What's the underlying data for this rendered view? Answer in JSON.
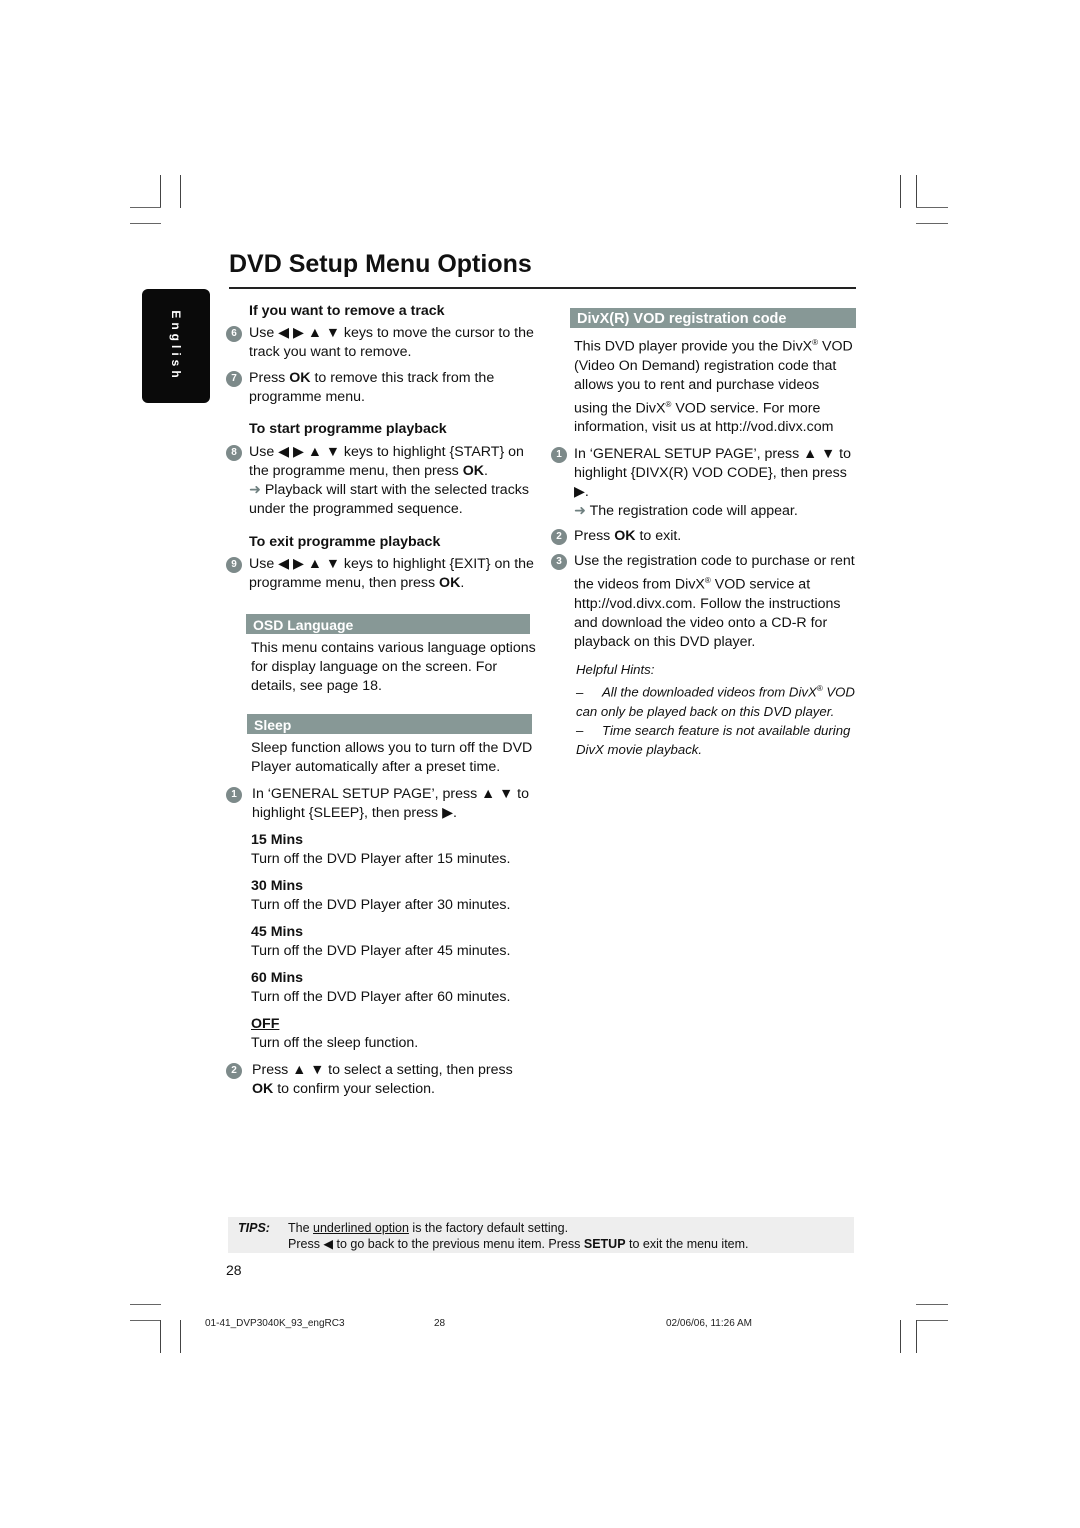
{
  "page": {
    "title": "DVD Setup Menu Options",
    "language_tab": "English",
    "page_number": "28"
  },
  "left_column": {
    "remove_track": {
      "heading": "If you want to remove a track",
      "steps": [
        {
          "num": "6",
          "pre": "Use ",
          "keys": "◀ ▶ ▲ ▼",
          "post": " keys to move the cursor to the track you want to remove."
        },
        {
          "num": "7",
          "pre": "Press ",
          "bold": "OK",
          "post": " to remove this track from the programme menu."
        }
      ]
    },
    "start_playback": {
      "heading": "To start programme playback",
      "step": {
        "num": "8",
        "pre": "Use ",
        "keys": "◀ ▶ ▲ ▼",
        "mid": " keys to highlight {START} on the programme menu, then press ",
        "bold": "OK",
        "post": "."
      },
      "result_arrow": "➜",
      "result": " Playback will start with the selected tracks under the programmed sequence."
    },
    "exit_playback": {
      "heading": "To exit programme playback",
      "step": {
        "num": "9",
        "pre": "Use ",
        "keys": "◀ ▶ ▲ ▼",
        "mid": " keys to highlight {EXIT} on the programme menu, then press ",
        "bold": "OK",
        "post": "."
      }
    },
    "osd_language": {
      "heading": "OSD Language",
      "body": "This menu contains various language options for display language on the screen. For details, see page 18."
    },
    "sleep": {
      "heading": "Sleep",
      "body": "Sleep function allows you to turn off the DVD Player automatically after a preset time.",
      "step1": {
        "num": "1",
        "text": "In ‘GENERAL SETUP PAGE’, press ▲ ▼ to highlight {SLEEP}, then press ▶."
      },
      "options": [
        {
          "title": "15 Mins",
          "desc": "Turn off the DVD Player after 15 minutes.",
          "default": false
        },
        {
          "title": "30 Mins",
          "desc": "Turn off the DVD Player after 30 minutes.",
          "default": false
        },
        {
          "title": "45 Mins",
          "desc": "Turn off the DVD Player after 45 minutes.",
          "default": false
        },
        {
          "title": "60 Mins",
          "desc": "Turn off the DVD Player after 60 minutes.",
          "default": false
        },
        {
          "title": "OFF",
          "desc": "Turn off the sleep function.",
          "default": true
        }
      ],
      "step2": {
        "num": "2",
        "pre": "Press ▲ ▼ to select a setting, then press ",
        "bold": "OK",
        "post": " to confirm your selection."
      }
    }
  },
  "right_column": {
    "divx": {
      "heading": "DivX(R) VOD registration code",
      "body_1": "This DVD player provide you the DivX",
      "body_2": " VOD (Video On Demand) registration code that allows you to rent and purchase videos using the DivX",
      "body_3": " VOD service. For more information, visit us at http://vod.divx.com",
      "reg_mark": "®",
      "steps": [
        {
          "num": "1",
          "text": "In ‘GENERAL SETUP PAGE’, press ▲ ▼ to highlight {DIVX(R) VOD CODE}, then press ▶."
        },
        {
          "num": "2",
          "pre": "Press ",
          "bold": "OK",
          "post": " to exit."
        },
        {
          "num": "3",
          "pre": "Use the registration code to purchase or rent the videos from DivX",
          "post": " VOD service at http://vod.divx.com. Follow the instructions and download the video onto a CD-R for playback on this DVD player."
        }
      ],
      "result_arrow": "➜",
      "result": " The registration code will appear."
    },
    "hints": {
      "title": "Helpful Hints:",
      "items": [
        {
          "dash": "–",
          "pre": "All the downloaded videos from DivX",
          "post": " VOD can only be played back on this DVD player."
        },
        {
          "dash": "–",
          "text": "Time search feature is not available during DivX movie playback."
        }
      ]
    }
  },
  "tips": {
    "label": "TIPS:",
    "line1_pre": "The ",
    "line1_underlined": "underlined option",
    "line1_post": " is the factory default setting.",
    "line2_pre": "Press ◀ to go back to the previous menu item. Press ",
    "line2_bold": "SETUP",
    "line2_post": " to exit the menu item."
  },
  "footer": {
    "file": "01-41_DVP3040K_93_engRC3",
    "page": "28",
    "datetime": "02/06/06, 11:26 AM"
  }
}
